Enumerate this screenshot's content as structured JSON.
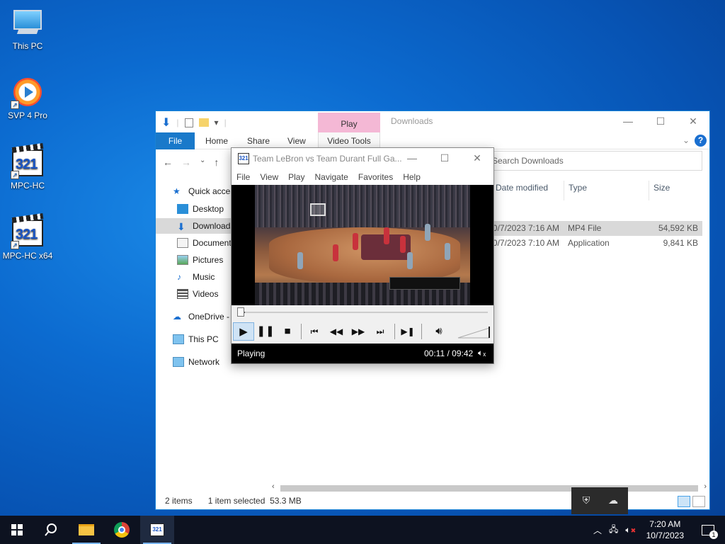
{
  "desktop": {
    "icons": [
      {
        "label": "This PC"
      },
      {
        "label": "SVP 4 Pro"
      },
      {
        "label": "MPC-HC"
      },
      {
        "label": "MPC-HC x64"
      }
    ]
  },
  "explorer": {
    "title": "Downloads",
    "context_tab": "Play",
    "ribbon_tabs": [
      "File",
      "Home",
      "Share",
      "View",
      "Video Tools"
    ],
    "search_placeholder": "Search Downloads",
    "nav": {
      "quick_access": "Quick access",
      "desktop": "Desktop",
      "downloads": "Downloads",
      "documents": "Documents",
      "pictures": "Pictures",
      "music": "Music",
      "videos": "Videos",
      "onedrive": "OneDrive - Personal",
      "this_pc": "This PC",
      "network": "Network"
    },
    "columns": {
      "modified": "Date modified",
      "type": "Type",
      "size": "Size"
    },
    "rows": [
      {
        "modified": "10/7/2023 7:16 AM",
        "type": "MP4 File",
        "size": "54,592 KB",
        "selected": true
      },
      {
        "modified": "10/7/2023 7:10 AM",
        "type": "Application",
        "size": "9,841 KB",
        "selected": false
      }
    ],
    "status": {
      "items": "2 items",
      "selected": "1 item selected",
      "size": "53.3 MB"
    }
  },
  "mpc": {
    "title": "Team LeBron vs Team Durant Full Ga...",
    "menu": [
      "File",
      "View",
      "Play",
      "Navigate",
      "Favorites",
      "Help"
    ],
    "status": "Playing",
    "time": "00:11 / 09:42",
    "progress": 0.019
  },
  "taskbar": {
    "clock_time": "7:20 AM",
    "clock_date": "10/7/2023",
    "notification_count": "1"
  },
  "colors": {
    "accent": "#1979ca",
    "context_tab": "#f4b8d5",
    "selection": "#d9d9d9"
  }
}
